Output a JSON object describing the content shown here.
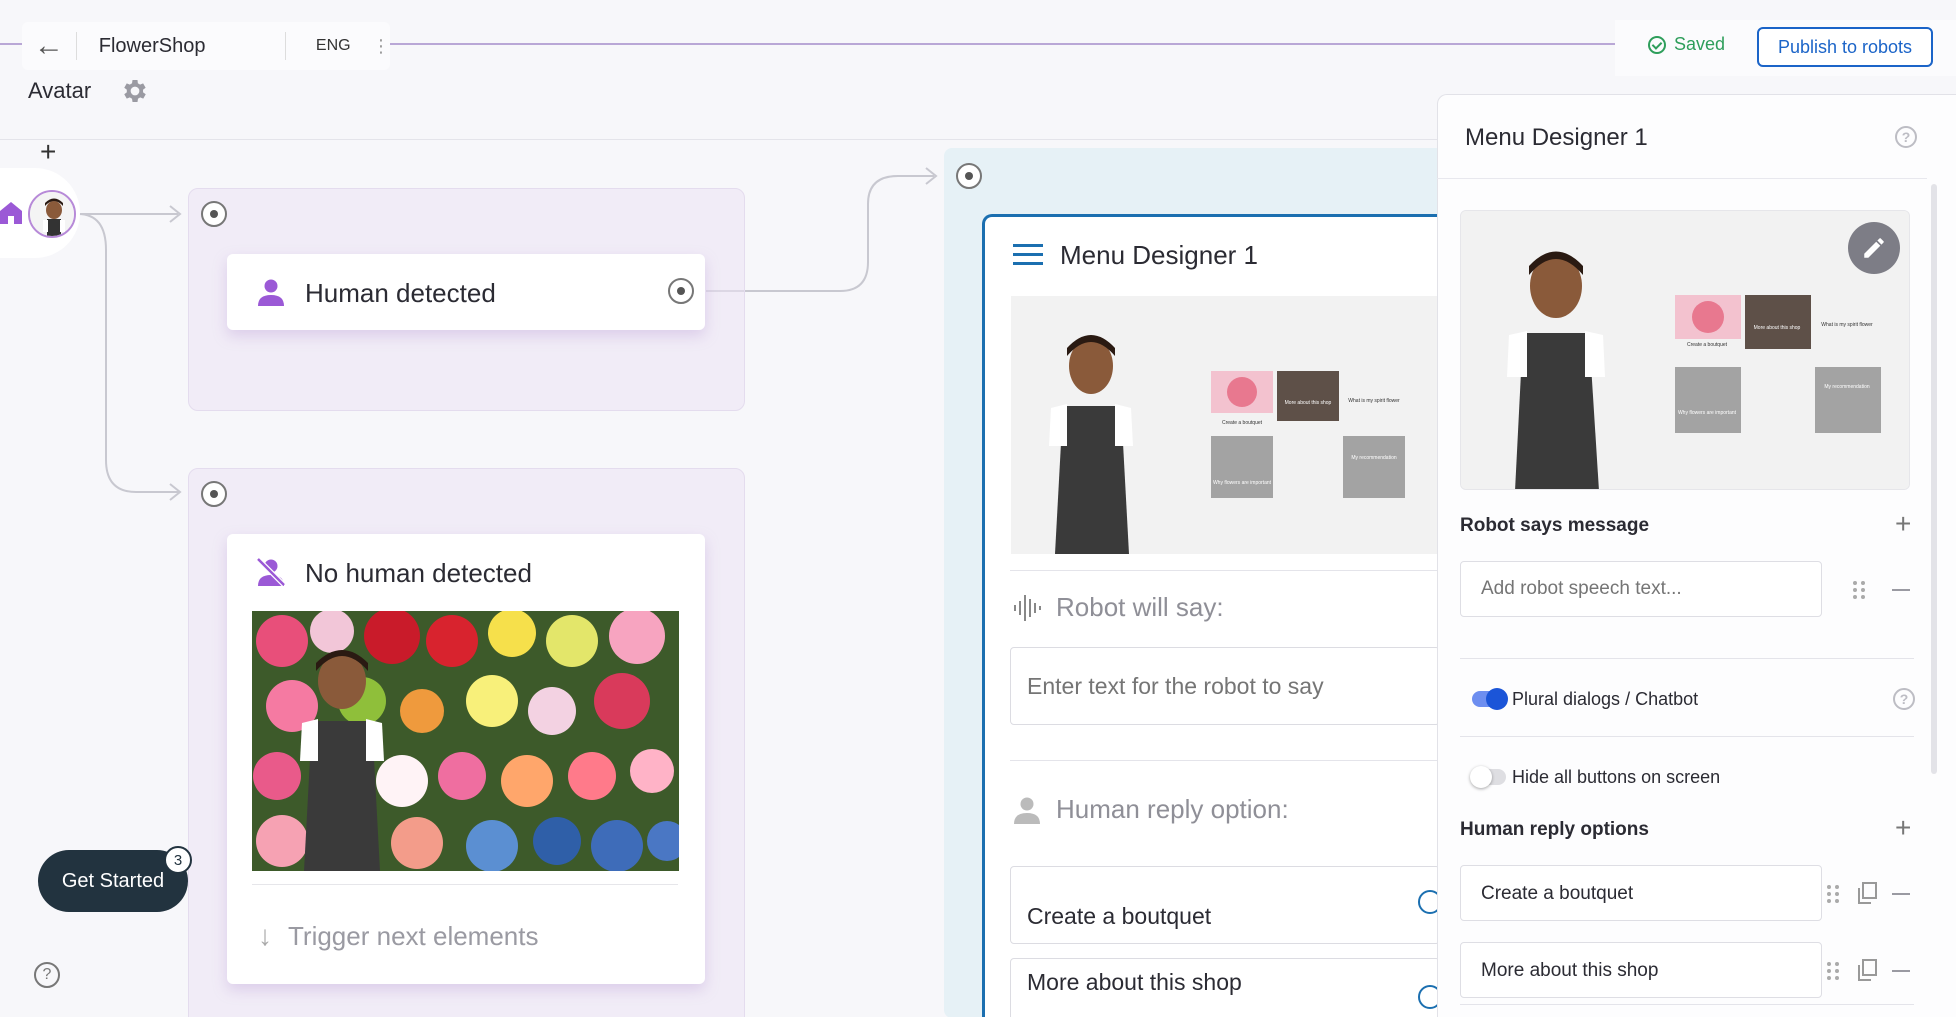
{
  "topbar": {
    "back_icon": "arrow-left-icon",
    "app_name": "FlowerShop",
    "language": "ENG",
    "more_icon": "vertical-dots-icon",
    "page_title": "Avatar",
    "settings_icon": "gear-icon",
    "add_icon": "plus-icon"
  },
  "status": {
    "saved_label": "Saved",
    "saved_color": "#2e9e5b",
    "publish_label": "Publish to robots",
    "accent_color": "#1b64c8"
  },
  "canvas": {
    "start_icon": "home-icon",
    "human_detected": {
      "title": "Human detected",
      "icon": "person-icon"
    },
    "no_human_detected": {
      "title": "No human detected",
      "icon": "person-off-icon",
      "trigger_label": "Trigger next elements"
    },
    "menu_designer": {
      "title": "Menu Designer 1",
      "robot_will_say_label": "Robot will say:",
      "robot_say_placeholder": "Enter text for the robot to say",
      "human_reply_label": "Human reply option:",
      "reply_options": [
        "Create a boutquet",
        "More about this shop"
      ]
    },
    "preview_tiles": [
      {
        "label": "Create a boutquet"
      },
      {
        "label": "More about this shop"
      },
      {
        "label": "What is my spirit flower"
      },
      {
        "label": "Why flowers are important"
      },
      {
        "label": "My recommendation"
      }
    ]
  },
  "get_started": {
    "label": "Get Started",
    "badge": "3"
  },
  "panel": {
    "title": "Menu Designer 1",
    "help_icon": "question-circle-icon",
    "edit_icon": "pencil-icon",
    "robot_says_label": "Robot says message",
    "speech_placeholder": "Add robot speech text...",
    "plural_dialogs_label": "Plural dialogs / Chatbot",
    "plural_dialogs_on": true,
    "hide_buttons_label": "Hide all buttons on screen",
    "hide_buttons_on": false,
    "human_reply_options_label": "Human reply options",
    "reply_options": [
      "Create a boutquet",
      "More about this shop"
    ]
  }
}
